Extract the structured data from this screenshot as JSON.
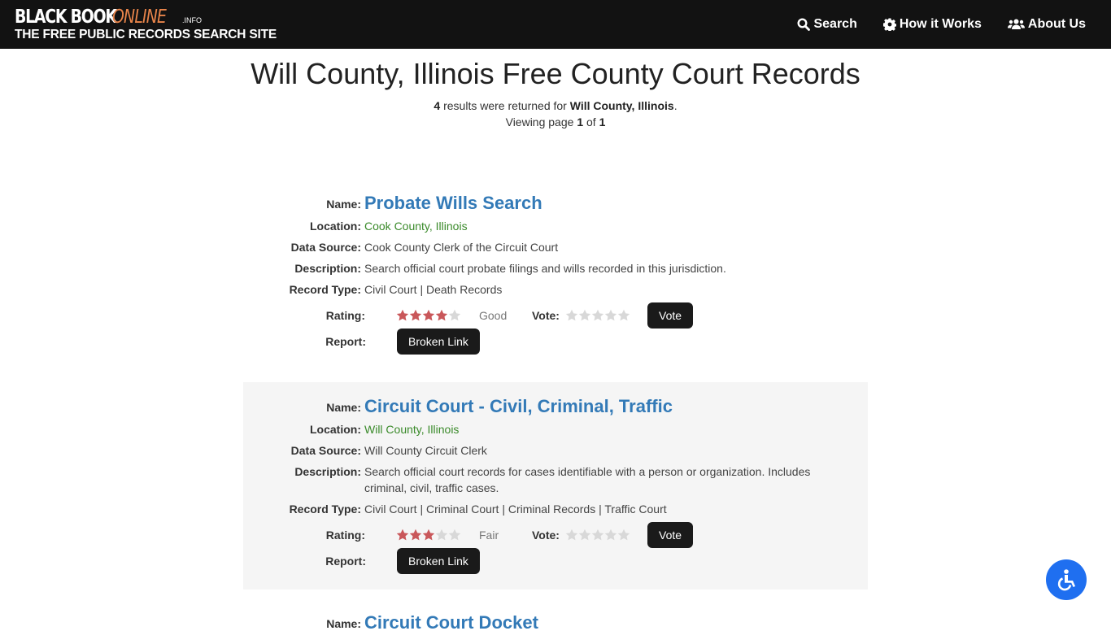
{
  "header": {
    "logo_main": "BLACK BOOK",
    "logo_accent": "ONLINE",
    "logo_suffix": ".INFO",
    "tagline": "THE FREE PUBLIC RECORDS SEARCH SITE",
    "nav": [
      {
        "label": "Search",
        "icon": "search-icon"
      },
      {
        "label": "How it Works",
        "icon": "gear-icon"
      },
      {
        "label": "About Us",
        "icon": "users-icon"
      }
    ]
  },
  "page": {
    "title": "Will County, Illinois Free County Court Records",
    "count": "4",
    "results_text": " results were returned for ",
    "query": "Will County, Illinois",
    "period": ".",
    "viewing_text": "Viewing page ",
    "page_num": "1",
    "of_text": " of ",
    "page_total": "1"
  },
  "labels": {
    "name": "Name:",
    "location": "Location:",
    "data_source": "Data Source:",
    "description": "Description:",
    "record_type": "Record Type:",
    "rating": "Rating:",
    "vote": "Vote:",
    "report": "Report:",
    "vote_button": "Vote",
    "broken_link_button": "Broken Link"
  },
  "results": [
    {
      "name": "Probate Wills Search",
      "location": "Cook County, Illinois",
      "data_source": "Cook County Clerk of the Circuit Court",
      "description": "Search official court probate filings and wills recorded in this jurisdiction.",
      "record_type": "Civil Court | Death Records",
      "rating": 4,
      "rating_max": 5,
      "rating_word": "Good"
    },
    {
      "name": "Circuit Court - Civil, Criminal, Traffic",
      "location": "Will County, Illinois",
      "data_source": "Will County Circuit Clerk",
      "description": "Search official court records for cases identifiable with a person or organization. Includes criminal, civil, traffic cases.",
      "record_type": "Civil Court | Criminal Court | Criminal Records | Traffic Court",
      "rating": 3,
      "rating_max": 5,
      "rating_word": "Fair"
    },
    {
      "name": "Circuit Court Docket"
    }
  ],
  "colors": {
    "header_bg": "#121212",
    "accent_orange": "#e8844a",
    "link_blue": "#337ab7",
    "location_green": "#3a8a2a",
    "star_filled": "#c9575a",
    "star_empty": "#d8d8d8",
    "a11y_blue": "#1f6ff0"
  }
}
